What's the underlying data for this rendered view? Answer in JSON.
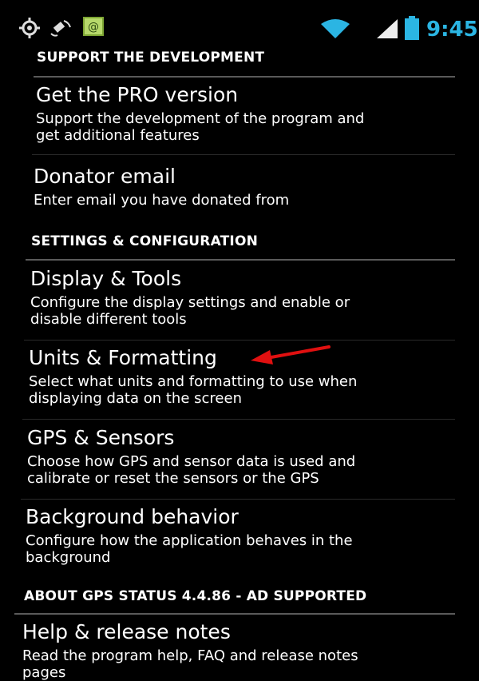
{
  "status_bar": {
    "icons": [
      "gps-icon",
      "satellite-icon",
      "mail-icon",
      "wifi-icon",
      "signal-icon",
      "battery-icon"
    ],
    "time": "9:45",
    "time_color": "#2bb5e3"
  },
  "sections": [
    {
      "header": "SUPPORT THE DEVELOPMENT",
      "items": [
        {
          "title": "Get the PRO version",
          "description": [
            "Support the development of the program and",
            "get additional features"
          ]
        },
        {
          "title": "Donator email",
          "description": [
            "Enter email you have donated from"
          ]
        }
      ]
    },
    {
      "header": "SETTINGS & CONFIGURATION",
      "items": [
        {
          "title": "Display & Tools",
          "description": [
            "Configure the display settings and enable or",
            "disable different tools"
          ]
        },
        {
          "title": "Units & Formatting",
          "description": [
            "Select what units and formatting to use when",
            "displaying data on the screen"
          ]
        },
        {
          "title": "GPS & Sensors",
          "description": [
            "Choose how GPS and sensor data is used and",
            "calibrate or reset the sensors or the GPS"
          ]
        },
        {
          "title": "Background behavior",
          "description": [
            "Configure how the application behaves in the",
            "background"
          ]
        }
      ]
    },
    {
      "header": "ABOUT GPS STATUS 4.4.86  - AD SUPPORTED",
      "items": [
        {
          "title": "Help & release notes",
          "description": [
            "Read the program help, FAQ and release notes",
            "pages"
          ]
        }
      ]
    }
  ],
  "annotation": {
    "arrow_color": "#e01010",
    "points_to": "Units & Formatting"
  }
}
